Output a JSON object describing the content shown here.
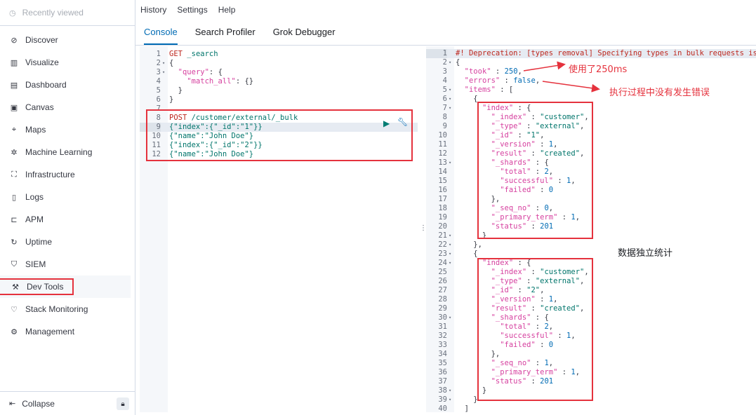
{
  "sidebar": {
    "recently_viewed": "Recently viewed",
    "items": [
      {
        "label": "Discover",
        "icon": "compass-icon"
      },
      {
        "label": "Visualize",
        "icon": "chart-icon"
      },
      {
        "label": "Dashboard",
        "icon": "dashboard-icon"
      },
      {
        "label": "Canvas",
        "icon": "canvas-icon"
      },
      {
        "label": "Maps",
        "icon": "map-icon"
      },
      {
        "label": "Machine Learning",
        "icon": "ml-icon"
      },
      {
        "label": "Infrastructure",
        "icon": "infrastructure-icon"
      },
      {
        "label": "Logs",
        "icon": "logs-icon"
      },
      {
        "label": "APM",
        "icon": "apm-icon"
      },
      {
        "label": "Uptime",
        "icon": "uptime-icon"
      },
      {
        "label": "SIEM",
        "icon": "siem-icon"
      },
      {
        "label": "Dev Tools",
        "icon": "devtools-icon"
      },
      {
        "label": "Stack Monitoring",
        "icon": "monitoring-icon"
      },
      {
        "label": "Management",
        "icon": "gear-icon"
      }
    ],
    "collapse_label": "Collapse"
  },
  "topmenu": {
    "history": "History",
    "settings": "Settings",
    "help": "Help"
  },
  "tabs": {
    "console": "Console",
    "search_profiler": "Search Profiler",
    "grok_debugger": "Grok Debugger"
  },
  "request_lines": [
    "GET _search",
    "{",
    "  \"query\": {",
    "    \"match_all\": {}",
    "  }",
    "}",
    "",
    "POST /customer/external/_bulk",
    "{\"index\":{\"_id\":\"1\"}}",
    "{\"name\":\"John Doe\"}",
    "{\"index\":{\"_id\":\"2\"}}",
    "{\"name\":\"John Doe\"}"
  ],
  "response_lines": [
    "#! Deprecation: [types removal] Specifying types in bulk requests is d",
    "{",
    "  \"took\" : 250,",
    "  \"errors\" : false,",
    "  \"items\" : [",
    "    {",
    "      \"index\" : {",
    "        \"_index\" : \"customer\",",
    "        \"_type\" : \"external\",",
    "        \"_id\" : \"1\",",
    "        \"_version\" : 1,",
    "        \"result\" : \"created\",",
    "        \"_shards\" : {",
    "          \"total\" : 2,",
    "          \"successful\" : 1,",
    "          \"failed\" : 0",
    "        },",
    "        \"_seq_no\" : 0,",
    "        \"_primary_term\" : 1,",
    "        \"status\" : 201",
    "      }",
    "    },",
    "    {",
    "      \"index\" : {",
    "        \"_index\" : \"customer\",",
    "        \"_type\" : \"external\",",
    "        \"_id\" : \"2\",",
    "        \"_version\" : 1,",
    "        \"result\" : \"created\",",
    "        \"_shards\" : {",
    "          \"total\" : 2,",
    "          \"successful\" : 1,",
    "          \"failed\" : 0",
    "        },",
    "        \"_seq_no\" : 1,",
    "        \"_primary_term\" : 1,",
    "        \"status\" : 201",
    "      }",
    "    }",
    "  ]"
  ],
  "annotations": {
    "took": "使用了250ms",
    "errors": "执行过程中没有发生错误",
    "items": "数据独立统计"
  },
  "colors": {
    "accent": "#006bb4",
    "annotation_red": "#e5323d"
  }
}
